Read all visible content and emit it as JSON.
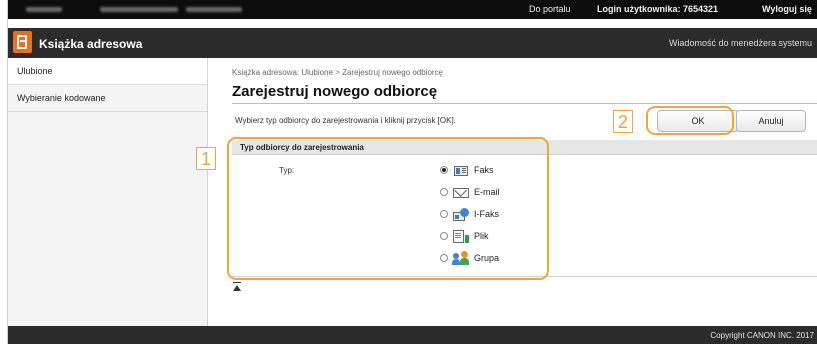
{
  "topbar": {
    "portal_link": "Do portalu",
    "login_text": "Login użytkownika:  7654321",
    "logout_link": "Wyloguj się"
  },
  "app": {
    "title": "Książka adresowa",
    "manager_message": "Wiadomość do menedżera systemu",
    "icon": "address-book-icon"
  },
  "sidebar": {
    "items": [
      {
        "label": "Ulubione",
        "active": true
      },
      {
        "label": "Wybieranie kodowane",
        "active": false
      }
    ]
  },
  "main": {
    "breadcrumb": "Książka adresowa: Ulubione > Zarejestruj nowego odbiorcę",
    "title": "Zarejestruj nowego odbiorcę",
    "instruction": "Wybierz typ odbiorcy do zarejestrowania i kliknij przycisk [OK].",
    "ok_label": "OK",
    "cancel_label": "Anuluj",
    "panel": {
      "heading": "Typ odbiorcy do zarejestrowania",
      "type_label": "Typ:",
      "selected": "Faks",
      "options": [
        {
          "label": "Faks",
          "icon": "fax-icon",
          "selected": true
        },
        {
          "label": "E-mail",
          "icon": "email-icon",
          "selected": false
        },
        {
          "label": "I-Faks",
          "icon": "ifax-icon",
          "selected": false
        },
        {
          "label": "Plik",
          "icon": "file-icon",
          "selected": false
        },
        {
          "label": "Grupa",
          "icon": "group-icon",
          "selected": false
        }
      ]
    }
  },
  "footer": {
    "copyright": "Copyright CANON INC. 2017"
  },
  "callouts": {
    "one": "1",
    "two": "2"
  },
  "colors": {
    "accent_orange": "#e8701e",
    "callout": "#f0a640",
    "header_bg": "#2b2b2b",
    "topbar_bg": "#0c0c0c"
  }
}
